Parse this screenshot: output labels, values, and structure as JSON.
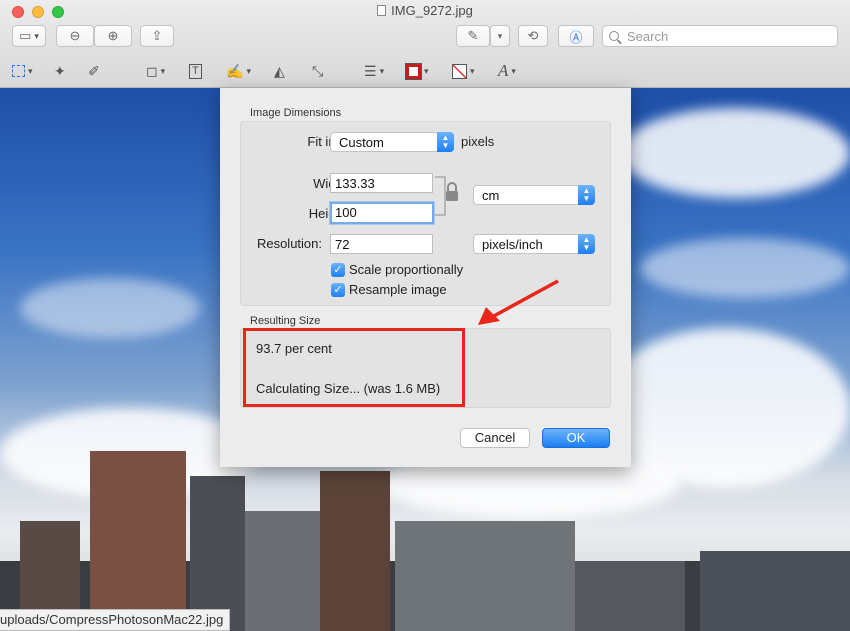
{
  "window": {
    "title": "IMG_9272.jpg"
  },
  "toolbar": {
    "search_placeholder": "Search"
  },
  "dialog": {
    "image_dimensions_label": "Image Dimensions",
    "fit_into_label": "Fit into:",
    "fit_into_value": "Custom",
    "fit_into_unit": "pixels",
    "width_label": "Width:",
    "width_value": "133.33",
    "height_label": "Height:",
    "height_value": "100",
    "size_unit": "cm",
    "resolution_label": "Resolution:",
    "resolution_value": "72",
    "resolution_unit": "pixels/inch",
    "scale_label": "Scale proportionally",
    "resample_label": "Resample image",
    "resulting_size_label": "Resulting Size",
    "percent_text": "93.7 per cent",
    "size_text": "Calculating Size... (was 1.6 MB)",
    "cancel_label": "Cancel",
    "ok_label": "OK"
  },
  "statusbar": {
    "path": "uploads/CompressPhotosonMac22.jpg"
  },
  "colors": {
    "accent": "#1e7ff3",
    "highlight": "#e8261a"
  }
}
